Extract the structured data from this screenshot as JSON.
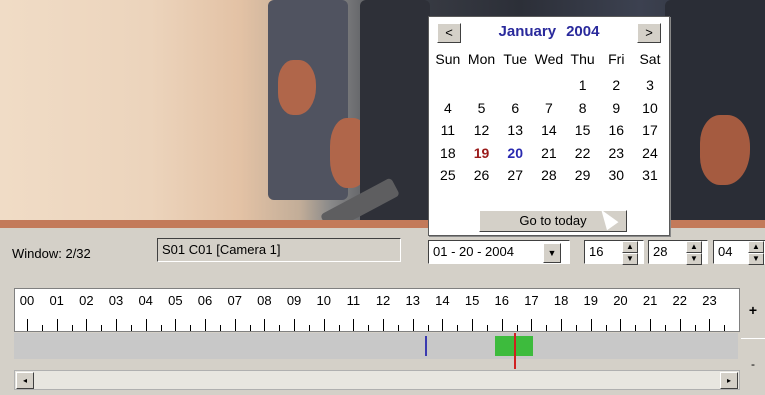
{
  "calendar": {
    "month": "January",
    "year": "2004",
    "prev_label": "<",
    "next_label": ">",
    "weekdays": [
      "Sun",
      "Mon",
      "Tue",
      "Wed",
      "Thu",
      "Fri",
      "Sat"
    ],
    "weeks": [
      [
        "",
        "",
        "",
        "",
        "1",
        "2",
        "3"
      ],
      [
        "4",
        "5",
        "6",
        "7",
        "8",
        "9",
        "10"
      ],
      [
        "11",
        "12",
        "13",
        "14",
        "15",
        "16",
        "17"
      ],
      [
        "18",
        "19",
        "20",
        "21",
        "22",
        "23",
        "24"
      ],
      [
        "25",
        "26",
        "27",
        "28",
        "29",
        "30",
        "31"
      ]
    ],
    "current_day": "19",
    "selected_day": "20",
    "colors": {
      "title": "#2a2a9c",
      "current": "#9a1a1a",
      "selected": "#2a2ab0"
    },
    "go_today_label": "Go to today"
  },
  "controls": {
    "window_label": "Window: 2/32",
    "camera_name": "S01 C01 [Camera 1]",
    "date_value": "01 - 20 - 2004",
    "hour_value": "16",
    "minute_value": "28",
    "second_value": "04"
  },
  "timeline": {
    "hours": [
      "00",
      "01",
      "02",
      "03",
      "04",
      "05",
      "06",
      "07",
      "08",
      "09",
      "10",
      "11",
      "12",
      "13",
      "14",
      "15",
      "16",
      "17",
      "18",
      "19",
      "20",
      "21",
      "22",
      "23"
    ],
    "zoom_in_label": "+",
    "zoom_out_label": "-",
    "recording_color": "#3dbb3d",
    "marker_color": "#d02020",
    "event_color": "#3a3ab0",
    "scroll_left": "◂",
    "scroll_right": "▸"
  }
}
